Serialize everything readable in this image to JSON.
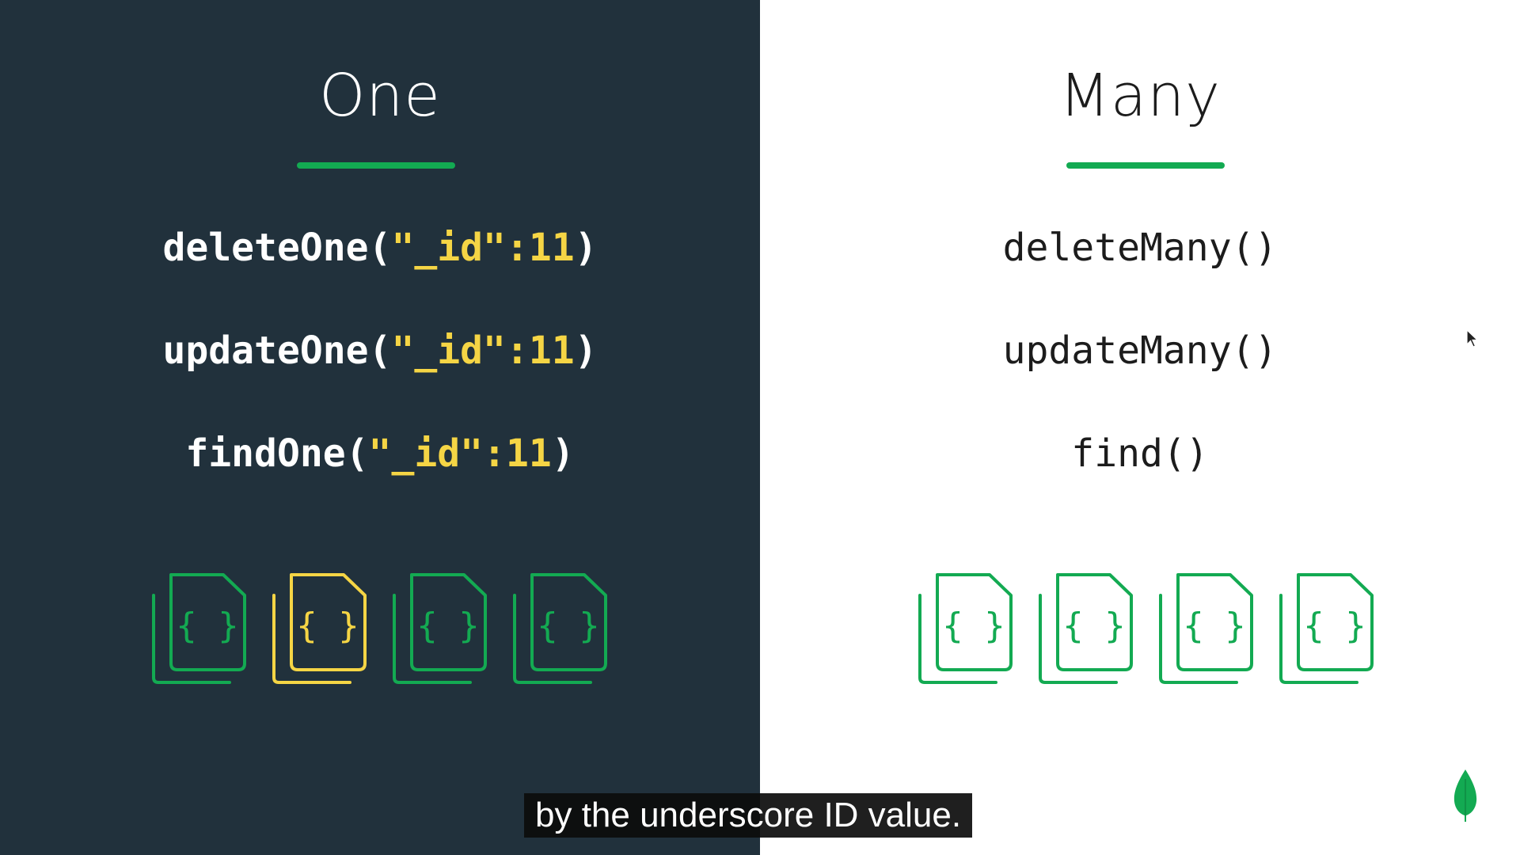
{
  "slide": {
    "left": {
      "heading": "One",
      "code": [
        {
          "fn": "deleteOne(",
          "arg": "\"_id\":11",
          "close": ")"
        },
        {
          "fn": "updateOne(",
          "arg": "\"_id\":11",
          "close": ")"
        },
        {
          "fn": "findOne(",
          "arg": "\"_id\":11",
          "close": ")"
        }
      ],
      "documents": [
        {
          "icon": "json-document-icon",
          "glyph": "{ }",
          "color": "#13aa52"
        },
        {
          "icon": "json-document-icon",
          "glyph": "{ }",
          "color": "#f5d545"
        },
        {
          "icon": "json-document-icon",
          "glyph": "{ }",
          "color": "#13aa52"
        },
        {
          "icon": "json-document-icon",
          "glyph": "{ }",
          "color": "#13aa52"
        }
      ]
    },
    "right": {
      "heading": "Many",
      "code": [
        "deleteMany()",
        "updateMany()",
        "find()"
      ],
      "documents": [
        {
          "icon": "json-document-icon",
          "glyph": "{ }",
          "color": "#13aa52"
        },
        {
          "icon": "json-document-icon",
          "glyph": "{ }",
          "color": "#13aa52"
        },
        {
          "icon": "json-document-icon",
          "glyph": "{ }",
          "color": "#13aa52"
        },
        {
          "icon": "json-document-icon",
          "glyph": "{ }",
          "color": "#13aa52"
        }
      ]
    },
    "colors": {
      "left_background": "#21313c",
      "right_background": "#ffffff",
      "accent_green": "#13aa52",
      "highlight_yellow": "#f5d545"
    },
    "logo_icon": "mongodb-leaf-icon",
    "pointer_icon": "mouse-cursor-icon"
  },
  "caption": {
    "text": "by the underscore ID value."
  }
}
